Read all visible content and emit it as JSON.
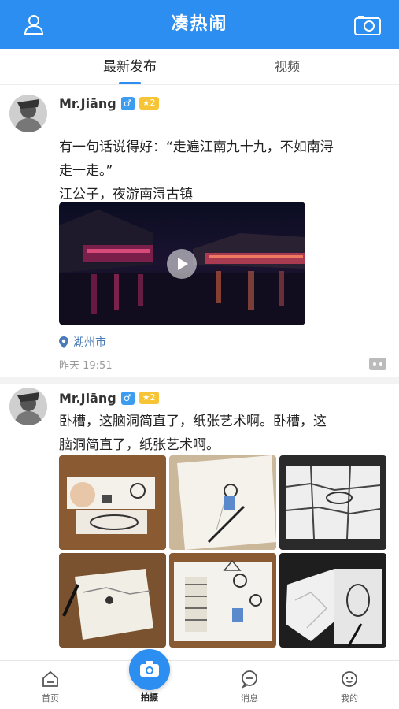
{
  "header": {
    "title": "凑热闹",
    "left_icon": "user-icon",
    "right_icon": "camera-icon",
    "color": "#2b8ef0"
  },
  "tabs": [
    {
      "label": "最新发布",
      "active": true
    },
    {
      "label": "视频",
      "active": false
    }
  ],
  "posts": [
    {
      "username": "Mr.Jiāng",
      "gender_icon": "♂",
      "level": "★2",
      "text_lines": [
        "有一句话说得好：“走遍江南九十九，不如南浔",
        "走一走。”",
        "江公子，夜游南浔古镇"
      ],
      "media": "video",
      "location": "湖州市",
      "time": "昨天 19:51"
    },
    {
      "username": "Mr.Jiāng",
      "gender_icon": "♂",
      "level": "★2",
      "text_lines": [
        "卧槽，这脑洞简直了，纸张艺术啊。卧槽，这",
        "脑洞简直了，纸张艺术啊。"
      ],
      "media": "images",
      "image_count": 6
    }
  ],
  "bottom_nav": {
    "items": [
      {
        "label": "首页",
        "icon": "home-icon"
      },
      {
        "label": "拍摄",
        "icon": "camera-icon"
      },
      {
        "label": "消息",
        "icon": "message-icon"
      },
      {
        "label": "我的",
        "icon": "profile-icon"
      }
    ]
  }
}
